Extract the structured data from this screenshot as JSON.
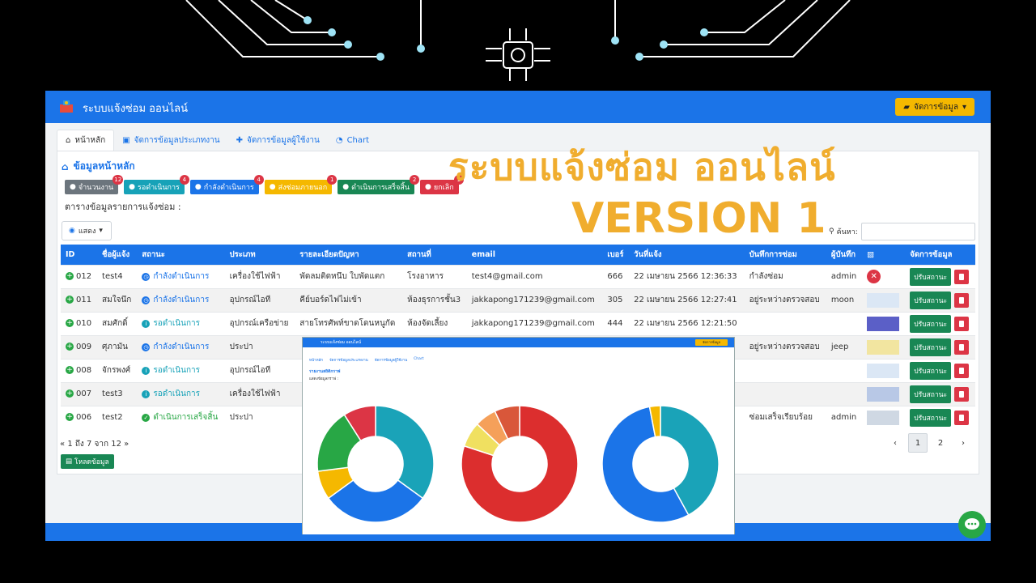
{
  "app": {
    "brand": "ระบบแจ้งซ่อม ออนไลน์",
    "manage_button": "จัดการข้อมูล",
    "tabs": [
      {
        "label": "หน้าหลัก"
      },
      {
        "label": "จัดการข้อมูลประเภทงาน"
      },
      {
        "label": "จัดการข้อมูลผู้ใช้งาน"
      },
      {
        "label": "Chart"
      }
    ]
  },
  "overlay": {
    "title_line1": "ระบบแจ้งซ่อม ออนไลน์",
    "title_line2": "VERSION 1"
  },
  "section": {
    "title": "ข้อมูลหน้าหลัก",
    "subtitle": "ตารางข้อมูลรายการแจ้งซ่อม :",
    "badges": [
      {
        "label": "จำนวนงาน",
        "count": "12",
        "color": "#6c757d"
      },
      {
        "label": "รอดำเนินการ",
        "count": "4",
        "color": "#17a2b8"
      },
      {
        "label": "กำลังดำเนินการ",
        "count": "4",
        "color": "#1b74e8"
      },
      {
        "label": "ส่งซ่อมภายนอก",
        "count": "1",
        "color": "#f5b800"
      },
      {
        "label": "ดำเนินการเสร็จสิ้น",
        "count": "2",
        "color": "#198754"
      },
      {
        "label": "ยกเลิก",
        "count": "1",
        "color": "#dc3545"
      }
    ]
  },
  "controls": {
    "show_label": "แสดง",
    "search_label": "ค้นหา:"
  },
  "table": {
    "headers": [
      "ID",
      "ชื่อผู้แจ้ง",
      "สถานะ",
      "ประเภท",
      "รายละเอียดปัญหา",
      "สถานที่",
      "email",
      "เบอร์",
      "วันที่แจ้ง",
      "บันทึกการซ่อม",
      "ผู้บันทึก",
      "",
      "จัดการข้อมูล"
    ],
    "rows": [
      {
        "id": "012",
        "name": "test4",
        "status": "กำลังดำเนินการ",
        "status_type": "blue",
        "type": "เครื่องใช้ไฟฟ้า",
        "detail": "พัดลมติดหนึบ ใบพัดแตก",
        "place": "โรงอาหาร",
        "email": "test4@gmail.com",
        "phone": "666",
        "date": "22 เมษายน 2566 12:36:33",
        "note": "กำลังซ่อม",
        "recorder": "admin",
        "image": "x"
      },
      {
        "id": "011",
        "name": "สมใจนึก",
        "status": "กำลังดำเนินการ",
        "status_type": "blue",
        "type": "อุปกรณ์ไอที",
        "detail": "คีย์บอร์ดไฟไม่เข้า",
        "place": "ห้องธุรการชั้น3",
        "email": "jakkapong171239@gmail.com",
        "phone": "305",
        "date": "22 เมษายน 2566 12:27:41",
        "note": "อยู่ระหว่างตรวจสอบ",
        "recorder": "moon",
        "image": "thumb"
      },
      {
        "id": "010",
        "name": "สมศักดิ์",
        "status": "รอดำเนินการ",
        "status_type": "cyan",
        "type": "อุปกรณ์เครือข่าย",
        "detail": "สายโทรศัพท์ขาดโดนหนูกัด",
        "place": "ห้องจัดเลี้ยง",
        "email": "jakkapong171239@gmail.com",
        "phone": "444",
        "date": "22 เมษายน 2566 12:21:50",
        "note": "",
        "recorder": "",
        "image": "thumb"
      },
      {
        "id": "009",
        "name": "ศุภามัน",
        "status": "กำลังดำเนินการ",
        "status_type": "blue",
        "type": "ประปา",
        "detail": "",
        "place": "",
        "email": "",
        "phone": "",
        "date": "",
        "note": "อยู่ระหว่างตรวจสอบ",
        "recorder": "jeep",
        "image": "thumb"
      },
      {
        "id": "008",
        "name": "จักรพงศ์",
        "status": "รอดำเนินการ",
        "status_type": "cyan",
        "type": "อุปกรณ์ไอที",
        "detail": "",
        "place": "",
        "email": "",
        "phone": "",
        "date": "",
        "note": "",
        "recorder": "",
        "image": "thumb"
      },
      {
        "id": "007",
        "name": "test3",
        "status": "รอดำเนินการ",
        "status_type": "cyan",
        "type": "เครื่องใช้ไฟฟ้า",
        "detail": "",
        "place": "",
        "email": "",
        "phone": "",
        "date": "",
        "note": "",
        "recorder": "",
        "image": "thumb"
      },
      {
        "id": "006",
        "name": "test2",
        "status": "ดำเนินการเสร็จสิ้น",
        "status_type": "green",
        "type": "ประปา",
        "detail": "",
        "place": "",
        "email": "",
        "phone": "",
        "date": "",
        "note": "ซ่อมเสร็จเรียบร้อย",
        "recorder": "admin",
        "image": "thumb"
      }
    ],
    "action_label": "ปรับสถานะ"
  },
  "pager": {
    "info": "1 ถึง 7 จาก 12",
    "pages": [
      "1",
      "2"
    ],
    "load_label": "โหลดข้อมูล"
  },
  "inset": {
    "brand": "ระบบแจ้งซ่อม ออนไลน์",
    "button": "จัดการข้อมูล",
    "tabs": [
      "หน้าหลัก",
      "จัดการข้อมูลประเภทงาน",
      "จัดการข้อมูลผู้ใช้งาน",
      "Chart"
    ],
    "chart_title": "รายงานสถิติกราฟ",
    "chart_subtitle": "แสดงข้อมูลกราฟ :"
  },
  "chart_data": [
    {
      "type": "pie",
      "slices": [
        {
          "value": 35,
          "color": "#1aa3b8"
        },
        {
          "value": 30,
          "color": "#1b74e8"
        },
        {
          "value": 8,
          "color": "#f5b800"
        },
        {
          "value": 18,
          "color": "#28a745"
        },
        {
          "value": 9,
          "color": "#dc3545"
        }
      ]
    },
    {
      "type": "pie",
      "slices": [
        {
          "value": 80,
          "color": "#dc2e2e"
        },
        {
          "value": 7,
          "color": "#f0e060"
        },
        {
          "value": 6,
          "color": "#f5a05a"
        },
        {
          "value": 7,
          "color": "#d9573a"
        }
      ]
    },
    {
      "type": "pie",
      "slices": [
        {
          "value": 42,
          "color": "#1aa3b8"
        },
        {
          "value": 55,
          "color": "#1b74e8"
        },
        {
          "value": 3,
          "color": "#f5b800"
        }
      ]
    }
  ]
}
